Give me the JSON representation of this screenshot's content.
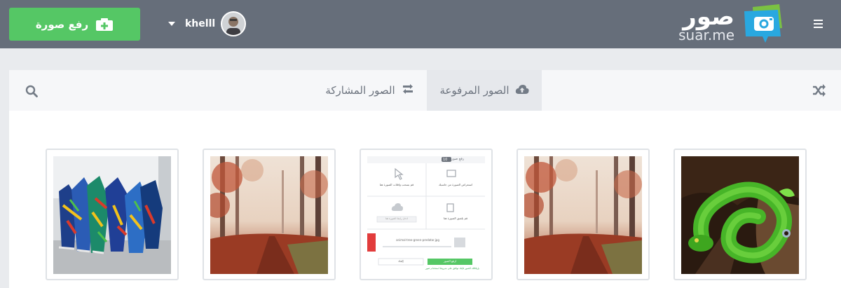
{
  "header": {
    "upload_label": "رفع صورة",
    "username": "khelll",
    "logo_arabic": "صور",
    "logo_latin": "suar.me"
  },
  "tabs": {
    "uploaded_label": "الصور المرفوعة",
    "shared_label": "الصور المشاركة"
  },
  "preview_screen": {
    "title": "رفع صور",
    "count": "10",
    "option_computer": "استعراض الصورة من جاسبك",
    "option_drag": "قم بسحب وافلات الصورة هنا",
    "option_paste": "قم بلصق الصورة هنا",
    "option_url_placeholder": "ادخل رابط الصورة هنا",
    "file_name": "animal-tree-green-predator.jpg",
    "upload_btn": "ارفع الصور",
    "cancel_btn": "إلغاء",
    "terms_note": "بإرفاقك الصور فإنك توافق على شروط استخدام صور"
  },
  "colors": {
    "topbar": "#666e7a",
    "upload_button": "#55c765",
    "tab_active_bg": "#e6e8ec",
    "text_muted": "#6c737e"
  },
  "icons": [
    "camera-plus-icon",
    "caret-down-icon",
    "menu-icon",
    "search-icon",
    "retweet-icon",
    "cloud-upload-icon",
    "shuffle-icon"
  ]
}
